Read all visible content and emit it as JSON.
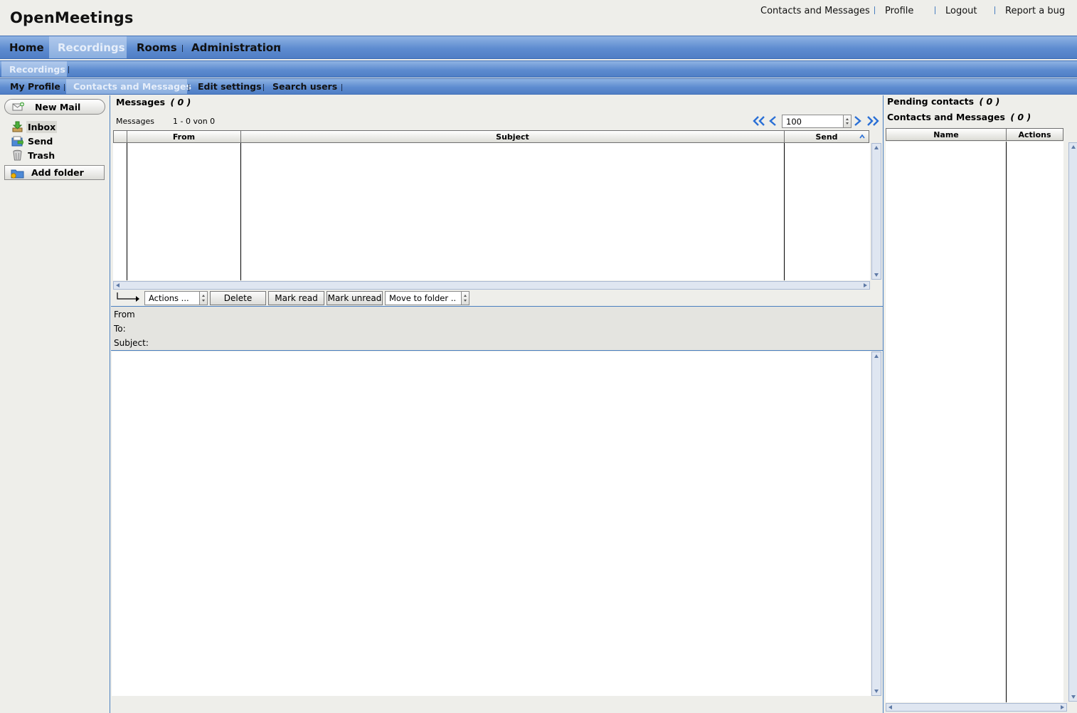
{
  "header": {
    "logo": "OpenMeetings",
    "links": {
      "contacts": "Contacts and Messages",
      "profile": "Profile",
      "logout": "Logout",
      "report_bug": "Report a bug"
    }
  },
  "nav": {
    "main": {
      "home": "Home",
      "recordings": "Recordings",
      "rooms": "Rooms",
      "administration": "Administration"
    },
    "sub": {
      "recordings": "Recordings"
    },
    "profile_tabs": {
      "my_profile": "My Profile",
      "contacts_messages": "Contacts and Messages",
      "edit_settings": "Edit settings",
      "search_users": "Search users"
    }
  },
  "sidebar": {
    "new_mail": "New Mail",
    "folders": {
      "inbox": "Inbox",
      "send": "Send",
      "trash": "Trash"
    },
    "add_folder": "Add folder"
  },
  "messages": {
    "title": "Messages",
    "count": "( 0 )",
    "list_label": "Messages",
    "range": "1 - 0 von 0",
    "page_size": "100",
    "columns": {
      "from": "From",
      "subject": "Subject",
      "send": "Send"
    },
    "actions_select": "Actions ...",
    "delete": "Delete",
    "mark_read": "Mark read",
    "mark_unread": "Mark unread",
    "move_to_folder": "Move to folder .."
  },
  "detail": {
    "from": "From",
    "to": "To:",
    "subject": "Subject:"
  },
  "contacts": {
    "pending_title": "Pending contacts",
    "pending_count": "( 0 )",
    "contacts_title": "Contacts and Messages",
    "contacts_count": "( 0 )",
    "columns": {
      "name": "Name",
      "actions": "Actions"
    }
  },
  "colors": {
    "nav_blue": "#5e8cd0",
    "accent_blue": "#4a7fc0",
    "pager_blue": "#2a6fd6"
  }
}
